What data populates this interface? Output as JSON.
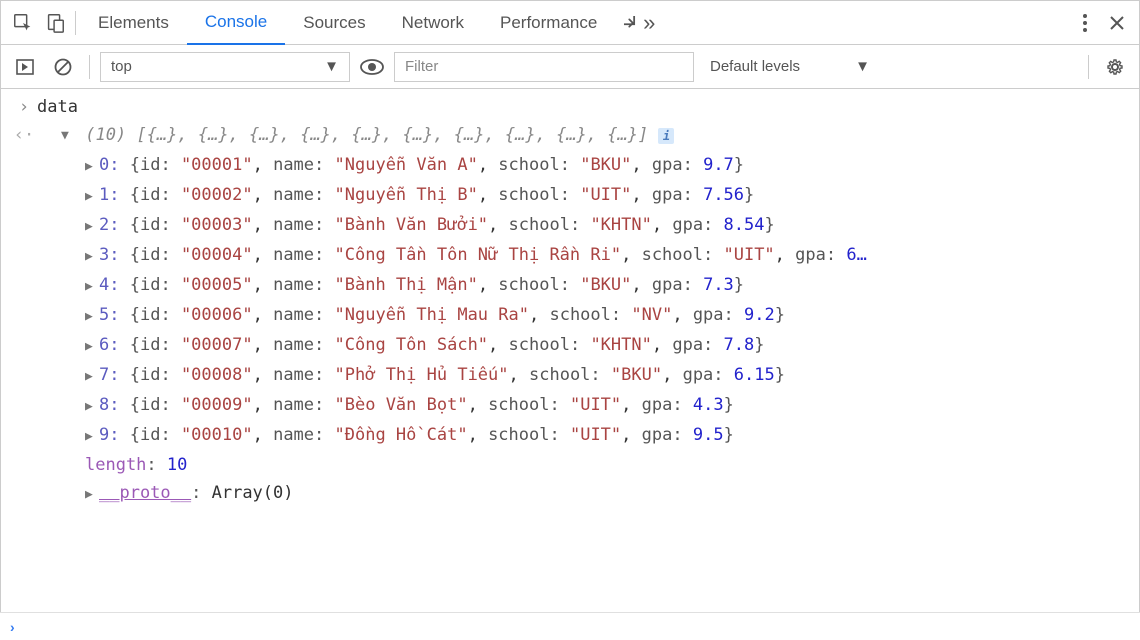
{
  "tabs": {
    "elements": "Elements",
    "console": "Console",
    "sources": "Sources",
    "network": "Network",
    "performance": "Performance"
  },
  "toolbar": {
    "context": "top",
    "filter_placeholder": "Filter",
    "levels": "Default levels"
  },
  "input_expr": "data",
  "array": {
    "count": "(10)",
    "summary_item": "{…}",
    "length_label": "length",
    "length_value": "10",
    "proto_label": "__proto__",
    "proto_value": "Array(0)"
  },
  "keys": {
    "id": "id",
    "name": "name",
    "school": "school",
    "gpa": "gpa"
  },
  "items": [
    {
      "idx": "0",
      "id": "00001",
      "name": "Nguyễn Văn A",
      "school": "BKU",
      "gpa": "9.7",
      "trunc": false
    },
    {
      "idx": "1",
      "id": "00002",
      "name": "Nguyễn Thị B",
      "school": "UIT",
      "gpa": "7.56",
      "trunc": false
    },
    {
      "idx": "2",
      "id": "00003",
      "name": "Bành Văn Bưởi",
      "school": "KHTN",
      "gpa": "8.54",
      "trunc": false
    },
    {
      "idx": "3",
      "id": "00004",
      "name": "Công Tần Tôn Nữ Thị Rần Ri",
      "school": "UIT",
      "gpa": "6…",
      "trunc": true
    },
    {
      "idx": "4",
      "id": "00005",
      "name": "Bành Thị Mận",
      "school": "BKU",
      "gpa": "7.3",
      "trunc": false
    },
    {
      "idx": "5",
      "id": "00006",
      "name": "Nguyễn Thị Mau Ra",
      "school": "NV",
      "gpa": "9.2",
      "trunc": false
    },
    {
      "idx": "6",
      "id": "00007",
      "name": "Công Tôn Sách",
      "school": "KHTN",
      "gpa": "7.8",
      "trunc": false
    },
    {
      "idx": "7",
      "id": "00008",
      "name": "Phở Thị Hủ Tiếu",
      "school": "BKU",
      "gpa": "6.15",
      "trunc": false
    },
    {
      "idx": "8",
      "id": "00009",
      "name": "Bèo Văn Bọt",
      "school": "UIT",
      "gpa": "4.3",
      "trunc": false
    },
    {
      "idx": "9",
      "id": "00010",
      "name": "Đồng Hồ Cát",
      "school": "UIT",
      "gpa": "9.5",
      "trunc": false
    }
  ]
}
